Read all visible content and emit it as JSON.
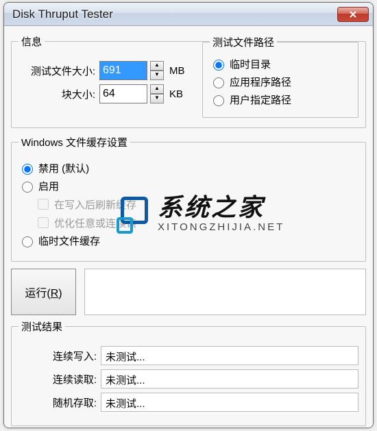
{
  "window": {
    "title": "Disk Thruput Tester"
  },
  "info": {
    "legend": "信息",
    "file_size_label": "测试文件大小:",
    "file_size_value": "691",
    "file_size_unit": "MB",
    "block_size_label": "块大小:",
    "block_size_value": "64",
    "block_size_unit": "KB",
    "path_legend": "测试文件路径",
    "path_options": {
      "temp": "临时目录",
      "app": "应用程序路径",
      "user": "用户指定路径"
    }
  },
  "cache": {
    "legend": "Windows 文件缓存设置",
    "disable": "禁用 (默认)",
    "enable": "启用",
    "flush_after_write": "在写入后刷新缓存",
    "optimize_seq": "优化任意或连续读",
    "temp_cache": "临时文件缓存"
  },
  "run": {
    "button_label": "运行(",
    "button_accel": "R",
    "button_label_end": ")"
  },
  "results": {
    "legend": "测试结果",
    "seq_write_label": "连续写入:",
    "seq_write_value": "未测试...",
    "seq_read_label": "连续读取:",
    "seq_read_value": "未测试...",
    "rand_access_label": "随机存取:",
    "rand_access_value": "未测试..."
  },
  "watermark": {
    "cn": "系统之家",
    "en": "XITONGZHIJIA.NET"
  }
}
